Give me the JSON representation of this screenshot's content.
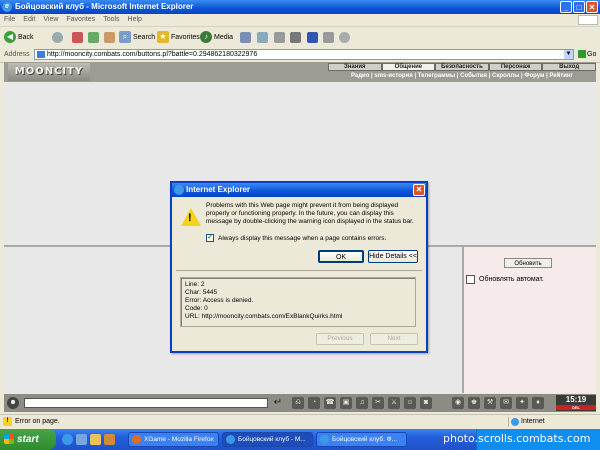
{
  "window": {
    "title": "Бойцовский клуб - Microsoft Internet Explorer",
    "min": "_",
    "max": "□",
    "close": "✕"
  },
  "menu": [
    "File",
    "Edit",
    "View",
    "Favorites",
    "Tools",
    "Help"
  ],
  "toolbar": {
    "back": "Back",
    "search": "Search",
    "favorites": "Favorites",
    "media": "Media"
  },
  "address": {
    "label": "Address",
    "url": "http://mooncity.combats.com/buttons.pl?battle=0.294862180322976",
    "go": "Go"
  },
  "game": {
    "logo": "MOONCITY",
    "nav_main": [
      "Знания",
      "Общение",
      "Безопасность",
      "Персонаж",
      "Выход"
    ],
    "nav_sub": "Радио | sms-история | Телеграммы | События | Скроллы | Форум | Рейтинг",
    "refresh_button": "Обновить",
    "auto_refresh_label": "Обновлять автомат."
  },
  "chat": {
    "emote": "☻",
    "send": "↵",
    "icons": [
      "⎌",
      "◔",
      "☎",
      "▣",
      "♫",
      "✂",
      "⚔",
      "☺",
      "◙",
      "◉",
      "♚",
      "⚒",
      "✉",
      "✦",
      "♦",
      "☼"
    ],
    "clock_time": "15:19",
    "clock_label": "DEL"
  },
  "dialog": {
    "title": "Internet Explorer",
    "close": "✕",
    "warning_glyph": "!",
    "message": "Problems with this Web page might prevent it from being displayed properly or functioning properly. In the future, you can display this message by double-clicking the warning icon displayed in the status bar.",
    "checkbox_label": "Always display this message when a page contains errors.",
    "checkbox_mark": "✓",
    "ok": "OK",
    "hide_details": "Hide Details <<",
    "details": {
      "line": "Line:  2",
      "char": "Char:  5445",
      "error": "Error:  Access is denied.",
      "code": "Code:  0",
      "url": "URL:  http://mooncity.combats.com/ExBlankQuirks.html"
    },
    "previous": "Previous",
    "next": "Next"
  },
  "status": {
    "warning_glyph": "!",
    "text": "Error on page.",
    "zone": "Internet"
  },
  "taskbar": {
    "start": "start",
    "tasks": [
      "XGame - Mozilla Firefox",
      "Бойцовский клуб - M...",
      "Бойцовский клуб. Ф..."
    ],
    "watermark": "photo.scrolls.combats.com"
  }
}
